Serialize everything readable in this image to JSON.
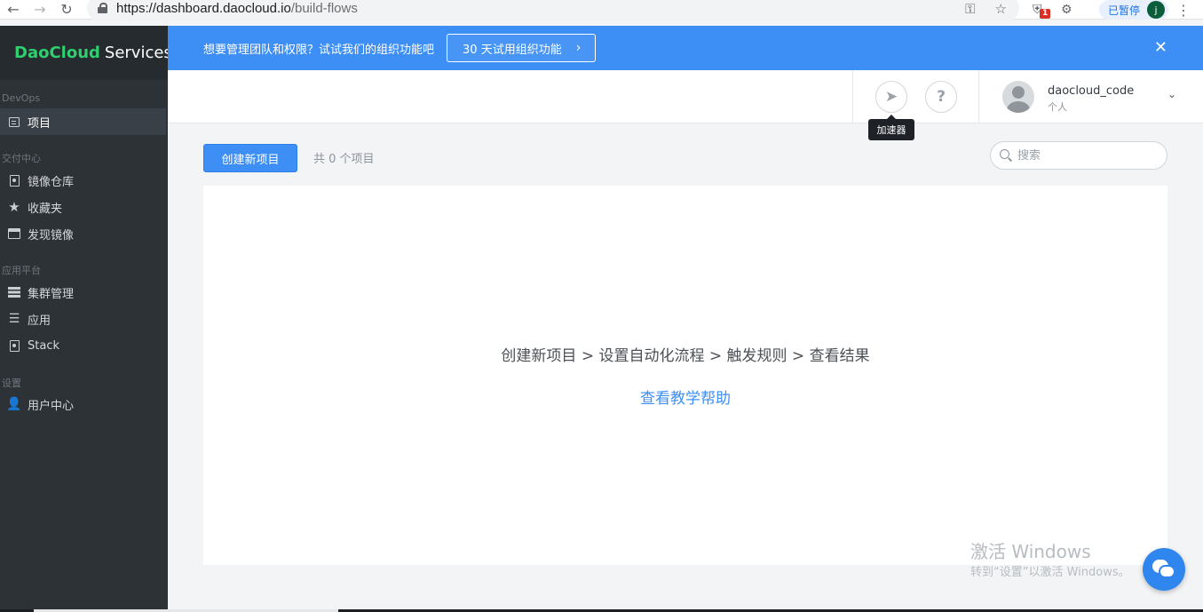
{
  "browser": {
    "url_main": "https://dashboard.daocloud.io",
    "url_path": "/build-flows",
    "paused_label": "已暂停",
    "profile_initial": "j",
    "extension_badge": "1"
  },
  "sidebar": {
    "brand_green": "DaoCloud",
    "brand_white": "Services",
    "sections": {
      "devops": "DevOps",
      "delivery": "交付中心",
      "platform": "应用平台",
      "settings": "设置"
    },
    "items": [
      {
        "label": "项目",
        "icon": "list-icon"
      },
      {
        "label": "镜像仓库",
        "icon": "repo-icon"
      },
      {
        "label": "收藏夹",
        "icon": "star-icon"
      },
      {
        "label": "发现镜像",
        "icon": "window-icon"
      },
      {
        "label": "集群管理",
        "icon": "cluster-icon"
      },
      {
        "label": "应用",
        "icon": "layers-icon"
      },
      {
        "label": "Stack",
        "icon": "stack-icon"
      },
      {
        "label": "用户中心",
        "icon": "user-icon"
      }
    ]
  },
  "banner": {
    "message": "想要管理团队和权限？试试我们的组织功能吧",
    "trial_button": "30 天试用组织功能"
  },
  "header": {
    "username": "daocloud_code",
    "account_type": "个人",
    "tooltip": "加速器"
  },
  "toolbar": {
    "create_button": "创建新项目",
    "count_text": "共 0 个项目",
    "search_placeholder": "搜索"
  },
  "empty_state": {
    "steps": "创建新项目 > 设置自动化流程 > 触发规则 > 查看结果",
    "tutorial_link": "查看教学帮助"
  },
  "watermark": {
    "line1": "激活 Windows",
    "line2": "转到“设置”以激活 Windows。"
  },
  "colors": {
    "accent": "#3d8ff5",
    "sidebar_bg": "#2d3237",
    "brand_green": "#2fce6f"
  }
}
